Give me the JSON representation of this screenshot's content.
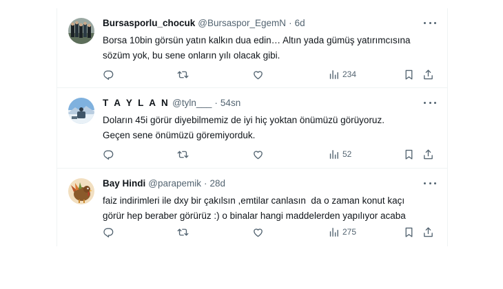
{
  "tweets": [
    {
      "name": "Bursasporlu_chocuk",
      "handle": "@Bursaspor_EgemN",
      "time": "6d",
      "lines": [
        "Borsa 10bin görsün yatın kalkın dua edin… Altın yada gümüş yatırımcısına",
        "sözüm yok, bu sene onların yılı olacak gibi."
      ],
      "views": "234"
    },
    {
      "name": "T A Y L A N",
      "handle": "@tyln___",
      "time": "54sn",
      "lines": [
        "Doların 45i görür diyebilmemiz de iyi hiç yoktan önümüzü görüyoruz.",
        "Geçen sene önümüzü göremiyorduk."
      ],
      "views": "52"
    },
    {
      "name": "Bay Hindi",
      "handle": "@parapemik",
      "time": "28d",
      "lines": [
        "faiz indirimleri ile dxy bir çakılsın ,emtilar canlasın  da o zaman konut kaçı",
        "görür hep beraber görürüz :) o binalar hangi maddelerden yapılıyor acaba"
      ],
      "views": "275"
    }
  ],
  "separator": "·",
  "icons": {
    "reply": "reply-icon",
    "retweet": "retweet-icon",
    "like": "like-icon",
    "views": "views-icon",
    "bookmark": "bookmark-icon",
    "share": "share-icon",
    "more": "more-icon"
  },
  "colors": {
    "text": "#0f1419",
    "secondary": "#536471",
    "border": "#eff3f4"
  }
}
